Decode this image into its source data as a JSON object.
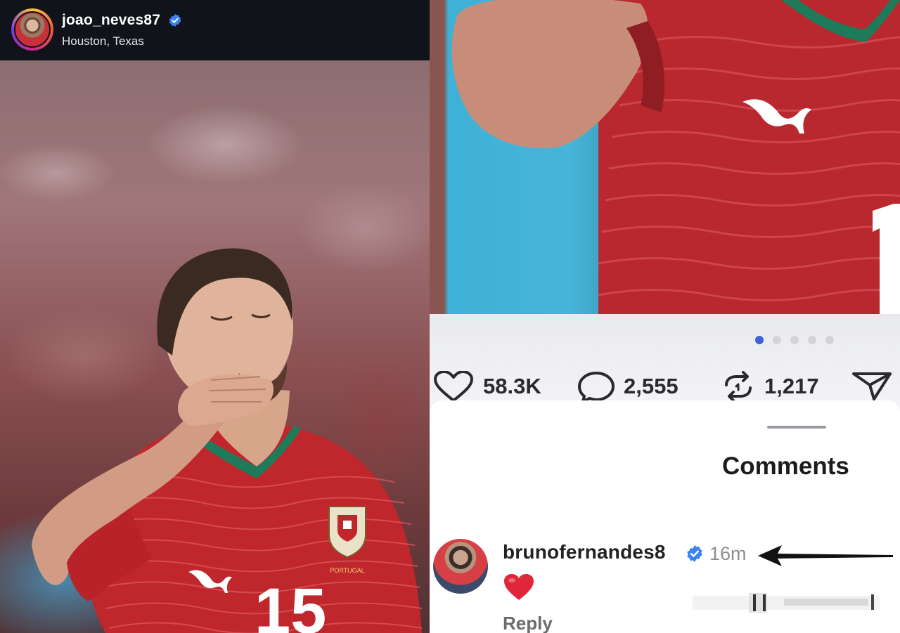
{
  "post": {
    "username": "joao_neves87",
    "location": "Houston, Texas",
    "shirt_number": "15",
    "crest_text": "PORTUGAL"
  },
  "stats": {
    "likes": "58.3K",
    "comments": "2,555",
    "reposts": "1,217"
  },
  "carousel": {
    "total_dots": 5,
    "active_index": 0
  },
  "comments_sheet": {
    "title": "Comments",
    "comment": {
      "username": "brunofernandes8",
      "time": "16m",
      "emoji": "❤️",
      "reply_label": "Reply"
    }
  },
  "colors": {
    "verified": "#3b82f6",
    "heart": "#e0263a",
    "active_dot": "#3f5ed9",
    "jersey_red": "#c0272d",
    "collar_green": "#1f7a5a"
  },
  "icons": {
    "like": "heart-outline-icon",
    "comment": "speech-bubble-icon",
    "repost": "repost-icon",
    "share": "paper-plane-icon",
    "verified": "verified-badge-icon"
  }
}
